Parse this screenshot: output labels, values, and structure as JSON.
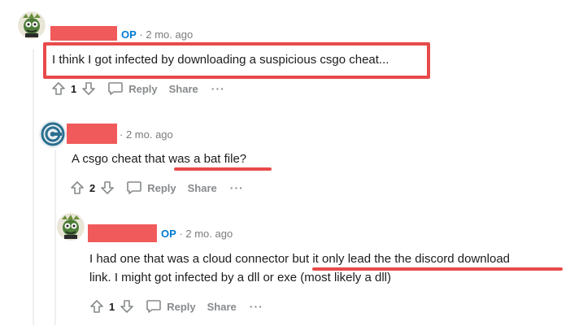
{
  "comments": [
    {
      "avatar_icon": "snoo-cartoon-avatar-icon",
      "op_badge": "OP",
      "time": "· 2 mo. ago",
      "body": "I think I got infected by downloading a suspicious csgo cheat...",
      "score": "1",
      "reply_label": "Reply",
      "share_label": "Share",
      "more_label": "···"
    },
    {
      "avatar_icon": "spiral-logo-avatar-icon",
      "op_badge": "",
      "time": "· 2 mo. ago",
      "body": "A csgo cheat that was a bat file?",
      "score": "2",
      "reply_label": "Reply",
      "share_label": "Share",
      "more_label": "···"
    },
    {
      "avatar_icon": "snoo-cartoon-avatar-icon",
      "op_badge": "OP",
      "time": "· 2 mo. ago",
      "body_line1": "I had one that was a cloud connector but it only lead the the discord download",
      "body_line2": "link. I might got infected by a dll or exe (most likely a dll)",
      "score": "1",
      "reply_label": "Reply",
      "share_label": "Share",
      "more_label": "···"
    }
  ],
  "colors": {
    "annotation_red": "#e84a4a",
    "redaction_red": "#f05a5a",
    "op_blue": "#0079d3",
    "meta_gray": "#7c7c7c"
  }
}
